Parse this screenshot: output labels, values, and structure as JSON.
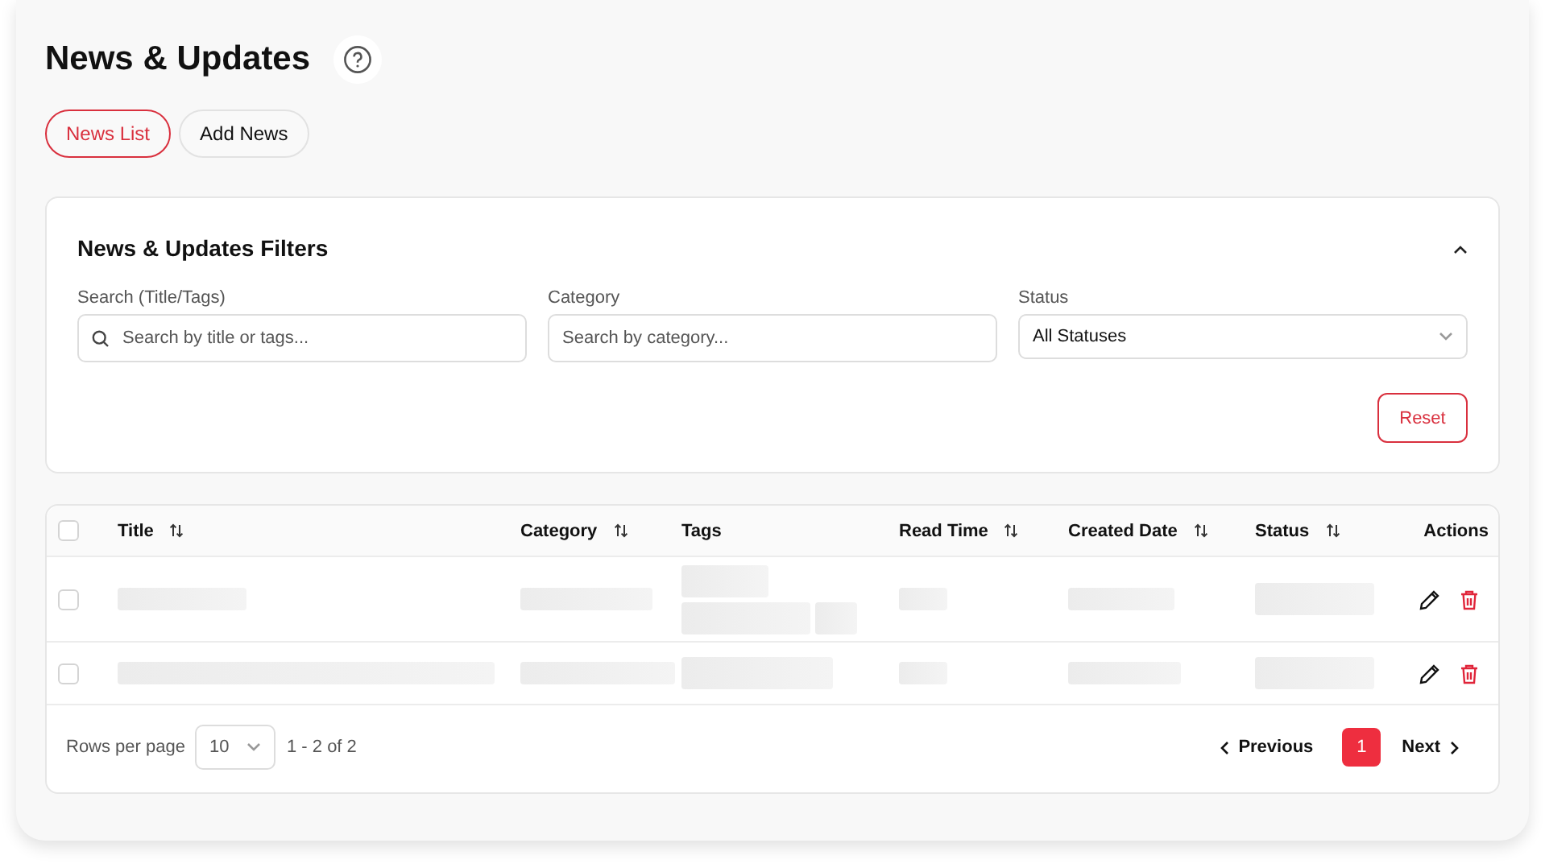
{
  "page": {
    "title": "News & Updates"
  },
  "tabs": [
    {
      "label": "News List",
      "selected": true
    },
    {
      "label": "Add News",
      "selected": false
    }
  ],
  "filters": {
    "title": "News & Updates Filters",
    "expanded": true,
    "fields": [
      {
        "kind": "search",
        "label": "Search (Title/Tags)",
        "placeholder": "Search by title or tags..."
      },
      {
        "kind": "text",
        "label": "Category",
        "placeholder": "Search by category..."
      },
      {
        "kind": "select",
        "label": "Status",
        "value": "All Statuses"
      }
    ],
    "reset": "Reset"
  },
  "table": {
    "all_checked": false,
    "columns": [
      {
        "label": "Title",
        "sortable": true
      },
      {
        "label": "Category",
        "sortable": true
      },
      {
        "label": "Tags",
        "sortable": false
      },
      {
        "label": "Read Time",
        "sortable": true
      },
      {
        "label": "Created Date",
        "sortable": true
      },
      {
        "label": "Status",
        "sortable": true
      },
      {
        "label": "Actions",
        "sortable": false
      }
    ],
    "rows": [
      {
        "checked": false
      },
      {
        "checked": false
      }
    ]
  },
  "pagination": {
    "rows_label": "Rows per page",
    "page_size": "10",
    "range": "1 - 2 of 2",
    "previous": "Previous",
    "pages": [
      {
        "label": "1",
        "selected": true
      }
    ],
    "next": "Next"
  }
}
